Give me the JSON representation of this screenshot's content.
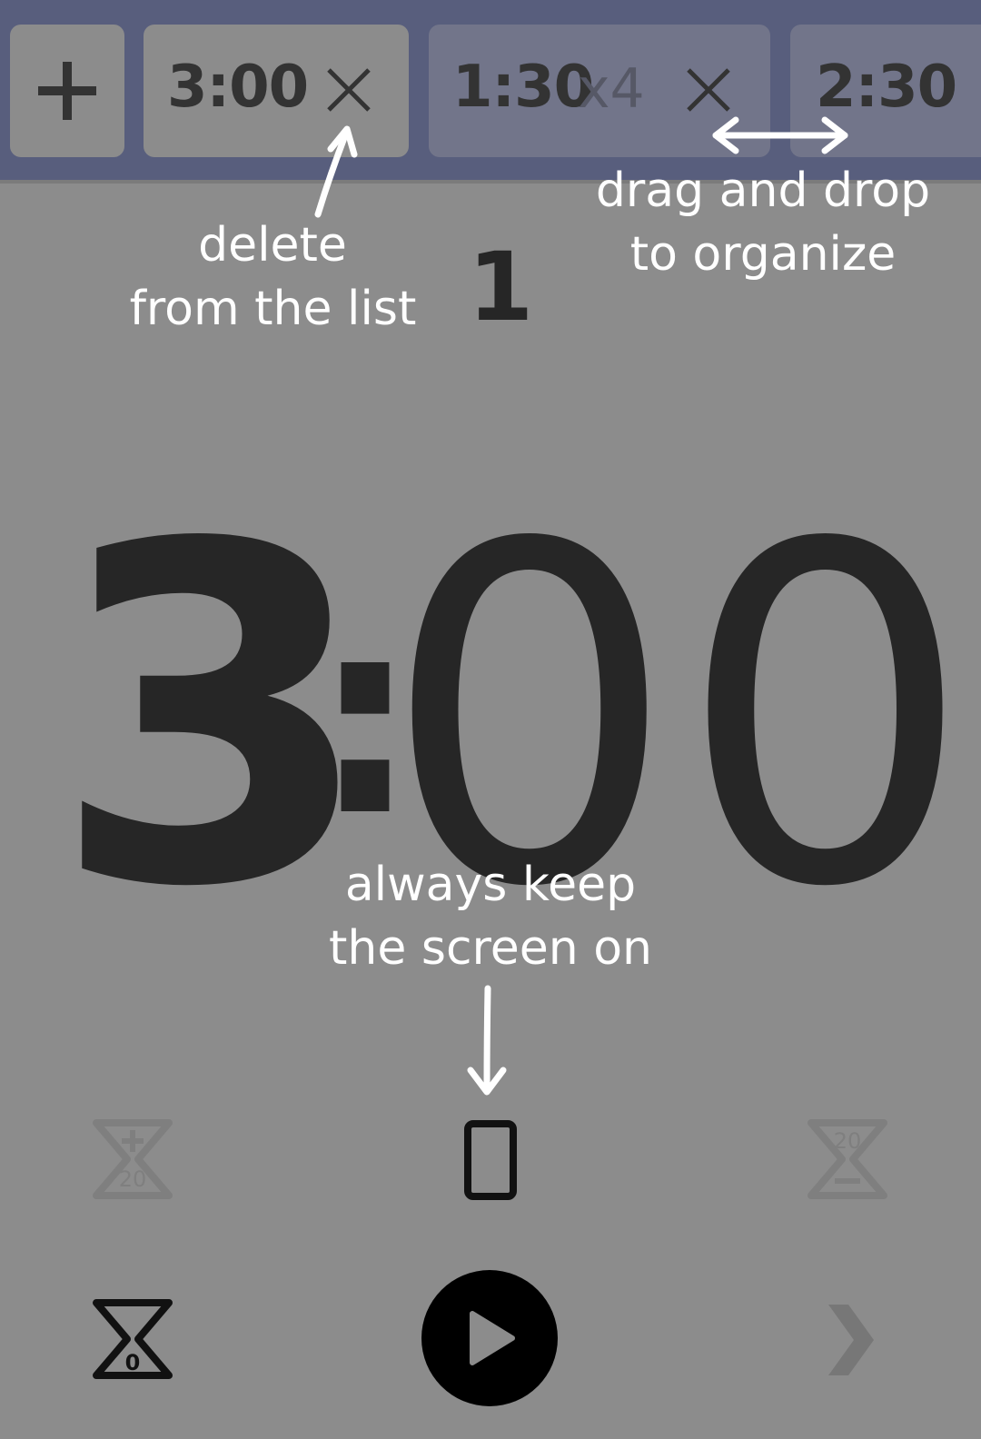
{
  "timer_list": {
    "add_symbol": "+",
    "items": [
      {
        "time": "3:00",
        "repeat": ""
      },
      {
        "time": "1:30",
        "repeat": "x4"
      },
      {
        "time": "2:30",
        "repeat": ""
      }
    ]
  },
  "annotations": {
    "delete_line1": "delete",
    "delete_line2": "from the list",
    "drag_line1": "drag and drop",
    "drag_line2": "to organize",
    "screen_line1": "always keep",
    "screen_line2": "the screen on"
  },
  "round_counter": "1",
  "clock": {
    "minutes": "3",
    "separator": ":",
    "seconds": "00"
  },
  "controls": {
    "add_time_value": "20",
    "subtract_time_value": "20",
    "reset_value": "0"
  },
  "colors": {
    "background": "#8c8c8c",
    "topbar": "#585e7d",
    "active_chip": "#8c8c8c",
    "inactive_chip": "#72758a",
    "text_dark": "#262626",
    "annotation": "#ffffff"
  },
  "icons": [
    "plus-icon",
    "close-icon",
    "add-time-icon",
    "keep-screen-on-icon",
    "subtract-time-icon",
    "reset-timer-icon",
    "play-icon",
    "next-icon"
  ]
}
